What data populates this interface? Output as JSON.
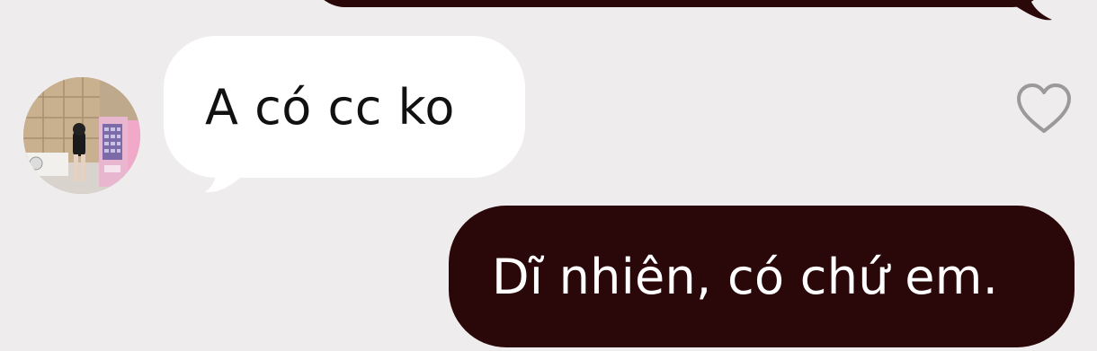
{
  "messages": [
    {
      "direction": "outgoing",
      "text": ""
    },
    {
      "direction": "incoming",
      "text": "A có cc ko",
      "sender_avatar": "avatar-photo"
    },
    {
      "direction": "outgoing",
      "text": "Dĩ nhiên, có chứ em."
    }
  ],
  "icons": {
    "react": "heart-outline-icon"
  },
  "colors": {
    "background": "#efeced",
    "outgoing_bubble": "#2a0709",
    "incoming_bubble": "#ffffff",
    "heart_outline": "#9a9a9a"
  }
}
